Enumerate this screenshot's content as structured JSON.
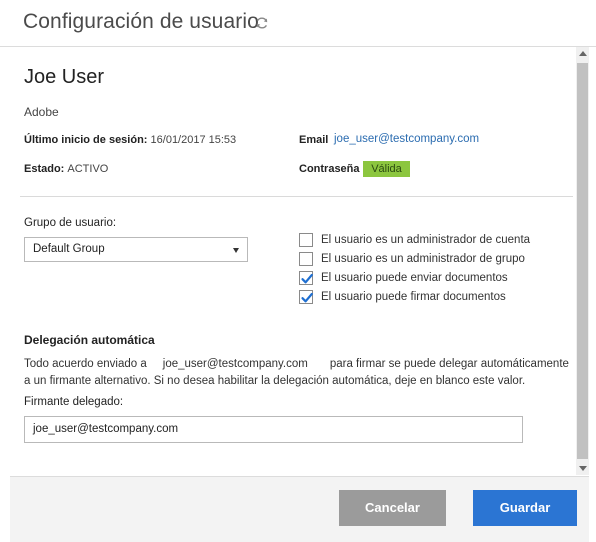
{
  "header": {
    "title": "Configuración de usuario",
    "refresh_icon": "refresh-icon"
  },
  "user": {
    "name": "Joe User",
    "organization": "Adobe",
    "last_login_label": "Último inicio de sesión:",
    "last_login_value": "16/01/2017 15:53",
    "email_label": "Email",
    "email_value": "joe_user@testcompany.com",
    "status_label": "Estado:",
    "status_value": "ACTIVO",
    "password_label": "Contraseña",
    "password_value": "Válida",
    "password_color": "#8cc63f"
  },
  "group": {
    "label": "Grupo de usuario:",
    "selected": "Default Group"
  },
  "permissions": [
    {
      "label": "El usuario es un administrador de cuenta",
      "checked": false
    },
    {
      "label": "El usuario es un administrador de grupo",
      "checked": false
    },
    {
      "label": "El usuario puede enviar documentos",
      "checked": true
    },
    {
      "label": "El usuario puede firmar documentos",
      "checked": true
    }
  ],
  "delegation": {
    "title": "Delegación automática",
    "text_before": "Todo acuerdo enviado a",
    "email": "joe_user@testcompany.com",
    "text_after": "para firmar se puede delegar automáticamente a un firmante alternativo. Si no desea habilitar la delegación automática, deje en blanco este valor.",
    "signer_label": "Firmante delegado:",
    "signer_value": "joe_user@testcompany.com"
  },
  "footer": {
    "cancel_label": "Cancelar",
    "save_label": "Guardar",
    "save_color": "#2b75d3",
    "cancel_color": "#9b9b9b"
  }
}
